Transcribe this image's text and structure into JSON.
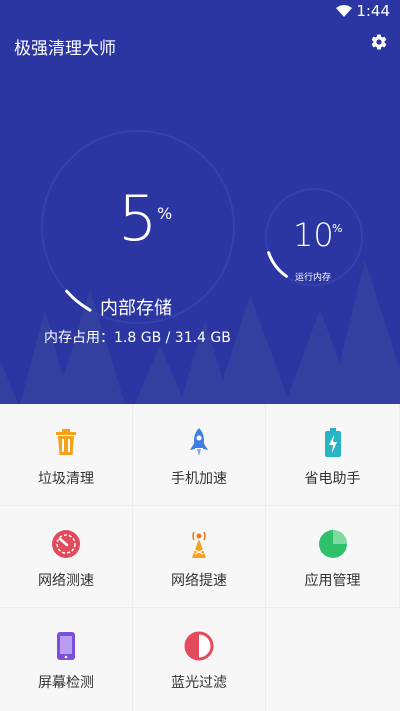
{
  "status_bar": {
    "time": "1:44"
  },
  "app": {
    "title": "极强清理大师"
  },
  "storage": {
    "percent": "5",
    "percent_sign": "%",
    "label": "内部存储",
    "usage": "内存占用：1.8 GB / 31.4 GB",
    "fill_fraction": 0.05
  },
  "ram": {
    "percent": "10",
    "percent_sign": "%",
    "label": "运行内存",
    "fill_fraction": 0.1
  },
  "colors": {
    "hero_bg": "#2b36a3",
    "orange": "#f5a11c",
    "blue": "#3e7fe6",
    "teal": "#27b5c4",
    "red": "#e34a5c",
    "green": "#2fc06a",
    "purple": "#7b4fd6"
  },
  "features": [
    {
      "label": "垃圾清理",
      "icon": "trash-icon"
    },
    {
      "label": "手机加速",
      "icon": "rocket-icon"
    },
    {
      "label": "省电助手",
      "icon": "battery-icon"
    },
    {
      "label": "网络测速",
      "icon": "speedometer-icon"
    },
    {
      "label": "网络提速",
      "icon": "signal-tower-icon"
    },
    {
      "label": "应用管理",
      "icon": "pie-chart-icon"
    },
    {
      "label": "屏幕检测",
      "icon": "phone-screen-icon"
    },
    {
      "label": "蓝光过滤",
      "icon": "half-circle-icon"
    }
  ]
}
